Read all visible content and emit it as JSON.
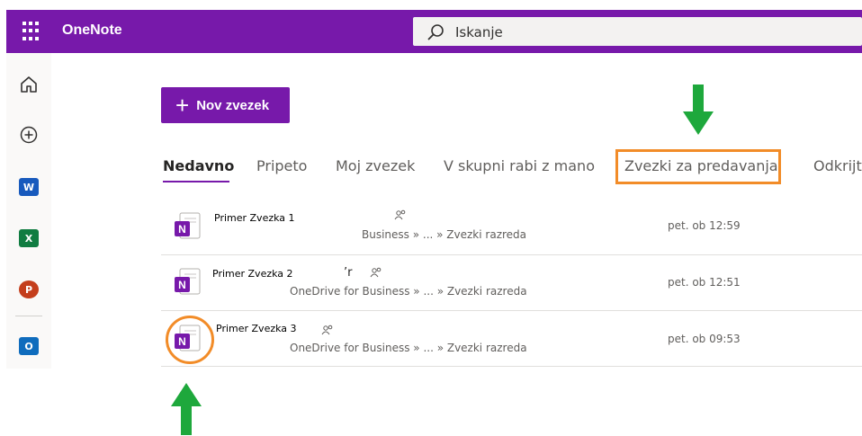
{
  "app": {
    "title": "OneNote",
    "waffle_icon": "waffle-icon"
  },
  "search": {
    "placeholder": "Iskanje"
  },
  "new_notebook": {
    "plus": "+",
    "label": "Nov zvezek"
  },
  "tabs": [
    {
      "label": "Nedavno",
      "active": true
    },
    {
      "label": "Pripeto"
    },
    {
      "label": "Moj zvezek"
    },
    {
      "label": "V skupni rabi z mano"
    },
    {
      "label": "Zvezki za predavanja",
      "highlighted": true
    },
    {
      "label": "Odkrijte"
    }
  ],
  "rail": [
    {
      "icon": "home-icon"
    },
    {
      "icon": "add-icon"
    },
    {
      "icon": "word-icon",
      "letter": "W",
      "color": "#185abd"
    },
    {
      "icon": "excel-icon",
      "letter": "X",
      "color": "#107c41"
    },
    {
      "icon": "powerpoint-icon",
      "letter": "P",
      "color": "#c43e1c"
    },
    {
      "icon": "outlook-icon",
      "letter": "O",
      "color": "#0f6cbd"
    }
  ],
  "notebooks": [
    {
      "name": "Primer Zvezka 1",
      "path": "Business » ... » Zvezki razreda",
      "time": "pet. ob 12:59"
    },
    {
      "name": "Primer Zvezka 2",
      "extra": "’r",
      "path": "OneDrive for Business » ... » Zvezki razreda",
      "time": "pet. ob 12:51"
    },
    {
      "name": "Primer Zvezka 3",
      "path": "OneDrive for Business » ... » Zvezki razreda",
      "time": "pet. ob 09:53"
    }
  ],
  "colors": {
    "brand": "#7719aa",
    "annotation_orange": "#f28c28",
    "annotation_green": "#1ea83c"
  }
}
